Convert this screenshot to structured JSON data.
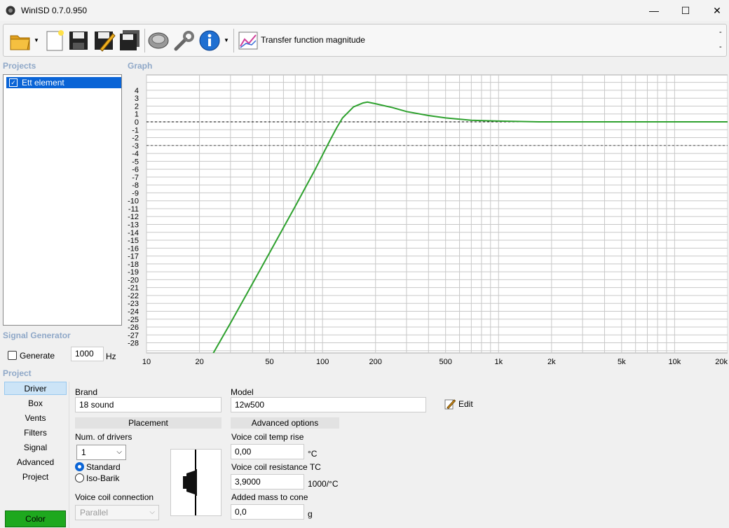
{
  "window": {
    "title": "WinISD 0.7.0.950",
    "minimize": "—",
    "maximize": "☐",
    "close": "✕"
  },
  "toolbar": {
    "icons": [
      "open-folder-icon",
      "new-document-icon",
      "save-icon",
      "save-as-icon",
      "save-all-icon",
      "speaker-driver-icon",
      "wrench-icon",
      "info-icon",
      "graph-icon"
    ],
    "graph_type": "Transfer function magnitude",
    "right_dashes": [
      "-",
      "-"
    ]
  },
  "projects": {
    "heading": "Projects",
    "items": [
      {
        "label": "Ett element",
        "checked": true
      }
    ]
  },
  "graph": {
    "heading": "Graph"
  },
  "signal_generator": {
    "heading": "Signal Generator",
    "generate_label": "Generate",
    "frequency": "1000",
    "unit": "Hz"
  },
  "project": {
    "heading": "Project",
    "nav": [
      "Driver",
      "Box",
      "Vents",
      "Filters",
      "Signal",
      "Advanced",
      "Project"
    ],
    "active": "Driver",
    "color_button": "Color"
  },
  "driver": {
    "brand_label": "Brand",
    "brand": "18 sound",
    "model_label": "Model",
    "model": "12w500",
    "edit_label": "Edit",
    "placement_header": "Placement",
    "advanced_header": "Advanced options",
    "num_drivers_label": "Num. of drivers",
    "num_drivers": "1",
    "standard_label": "Standard",
    "isobarik_label": "Iso-Barik",
    "vc_connection_label": "Voice coil connection",
    "vc_connection": "Parallel",
    "vc_temp_label": "Voice coil temp rise",
    "vc_temp": "0,00",
    "vc_temp_unit": "°C",
    "vc_res_label": "Voice coil resistance TC",
    "vc_res": "3,9000",
    "vc_res_unit": "1000/°C",
    "added_mass_label": "Added mass to cone",
    "added_mass": "0,0",
    "added_mass_unit": "g"
  },
  "chart_data": {
    "type": "line",
    "xscale": "log",
    "xlim": [
      10,
      20000
    ],
    "ylim": [
      -30,
      6
    ],
    "x_ticks": [
      10,
      20,
      50,
      100,
      200,
      500,
      1000,
      2000,
      5000,
      10000,
      20000
    ],
    "x_tick_labels": [
      "10",
      "20",
      "50",
      "100",
      "200",
      "500",
      "1k",
      "2k",
      "5k",
      "10k",
      "20k"
    ],
    "y_ticks": [
      4,
      3,
      2,
      1,
      0,
      -1,
      -2,
      -3,
      -4,
      -5,
      -6,
      -7,
      -8,
      -9,
      -10,
      -11,
      -12,
      -13,
      -14,
      -15,
      -16,
      -17,
      -18,
      -19,
      -20,
      -21,
      -22,
      -23,
      -24,
      -25,
      -26,
      -27,
      -28
    ],
    "reference_lines": [
      0,
      -3
    ],
    "grid": true,
    "line_color": "#2ea12e",
    "series": [
      {
        "x": [
          23,
          30,
          40,
          50,
          60,
          70,
          80,
          90,
          100,
          110,
          120,
          130,
          150,
          170,
          180,
          200,
          250,
          300,
          400,
          500,
          700,
          1000,
          1700,
          2000,
          5000,
          20000
        ],
        "y": [
          -30,
          -25.5,
          -20.5,
          -16.6,
          -13.4,
          -10.7,
          -8.3,
          -6.2,
          -4.2,
          -2.4,
          -0.8,
          0.5,
          1.9,
          2.4,
          2.5,
          2.3,
          1.8,
          1.3,
          0.8,
          0.5,
          0.2,
          0.1,
          0.0,
          0.0,
          0.0,
          0.0
        ]
      }
    ]
  }
}
